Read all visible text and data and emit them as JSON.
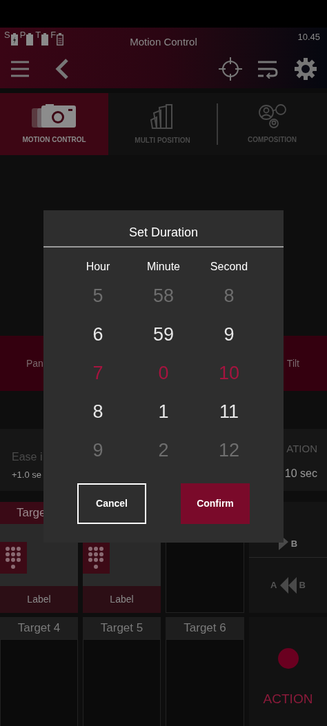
{
  "status_bar": {
    "batteries": [
      {
        "label": "S",
        "kind": "charging"
      },
      {
        "label": "P",
        "kind": "full"
      },
      {
        "label": "T",
        "kind": "full"
      },
      {
        "label": "F",
        "kind": "empty"
      }
    ],
    "title": "Motion Control",
    "time": "10.45"
  },
  "tabs": [
    {
      "label": "MOTION CONTROL",
      "selected": true,
      "kind": "camera"
    },
    {
      "label": "MULTI POSITION",
      "selected": false,
      "kind": "fan"
    },
    {
      "label": "COMPOSITION",
      "selected": false,
      "kind": "people"
    }
  ],
  "axis_band": {
    "left": "Pan",
    "right": "Tilt"
  },
  "ease": {
    "label": "Ease i",
    "value": "+1.0 se"
  },
  "duration": {
    "label": "ATION",
    "value": "10 sec"
  },
  "targets": [
    {
      "name": "Targe",
      "label": "Label",
      "assigned": true
    },
    {
      "label": "Label",
      "assigned": true
    },
    {
      "assigned": false
    },
    {
      "name": "Target 4",
      "assigned": false
    },
    {
      "name": "Target 5",
      "assigned": false
    },
    {
      "name": "Target 6",
      "assigned": false
    }
  ],
  "playback": {
    "forward_end": "B",
    "reverse_start": "A",
    "reverse_end": "B"
  },
  "action": {
    "label": "ACTION"
  },
  "dialog": {
    "title": "Set Duration",
    "columns": [
      {
        "header": "Hour",
        "values": [
          {
            "text": "5",
            "selected": false,
            "faded": true
          },
          {
            "text": "6",
            "selected": false,
            "faded": false
          },
          {
            "text": "7",
            "selected": true,
            "faded": false
          },
          {
            "text": "8",
            "selected": false,
            "faded": false
          },
          {
            "text": "9",
            "selected": false,
            "faded": true
          }
        ]
      },
      {
        "header": "Minute",
        "values": [
          {
            "text": "58",
            "selected": false,
            "faded": true
          },
          {
            "text": "59",
            "selected": false,
            "faded": false
          },
          {
            "text": "0",
            "selected": true,
            "faded": false
          },
          {
            "text": "1",
            "selected": false,
            "faded": false
          },
          {
            "text": "2",
            "selected": false,
            "faded": true
          }
        ]
      },
      {
        "header": "Second",
        "values": [
          {
            "text": "8",
            "selected": false,
            "faded": true
          },
          {
            "text": "9",
            "selected": false,
            "faded": false
          },
          {
            "text": "10",
            "selected": true,
            "faded": false
          },
          {
            "text": "11",
            "selected": false,
            "faded": false
          },
          {
            "text": "12",
            "selected": false,
            "faded": true
          }
        ]
      }
    ],
    "buttons": [
      {
        "label": "Cancel",
        "kind": "outline"
      },
      {
        "label": "Confirm",
        "kind": "primary"
      }
    ]
  }
}
